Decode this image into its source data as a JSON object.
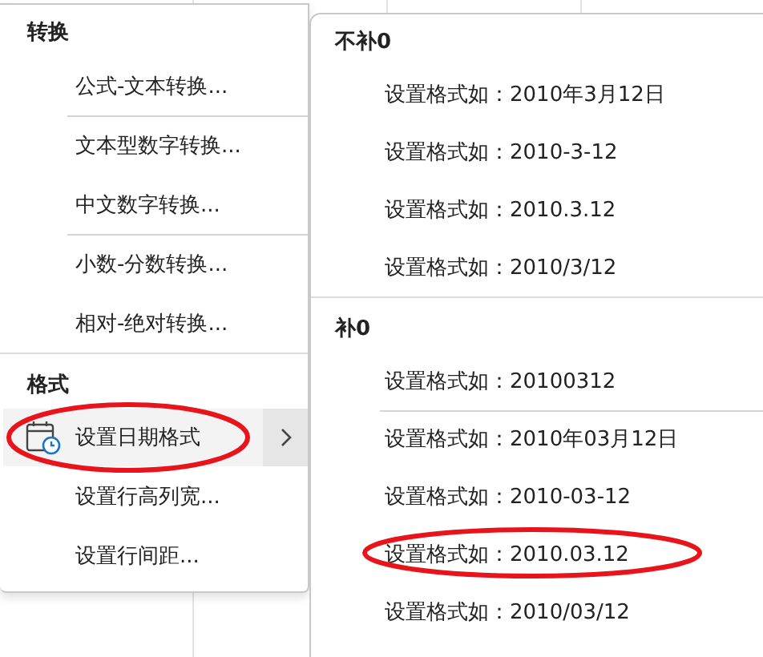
{
  "menu": {
    "sections": [
      {
        "heading": "转换",
        "items": [
          {
            "label": "公式-文本转换...",
            "divider_before": false,
            "selected": false,
            "has_icon": false,
            "has_submenu": false,
            "circled": false
          },
          {
            "label": "文本型数字转换...",
            "divider_before": true,
            "selected": false,
            "has_icon": false,
            "has_submenu": false,
            "circled": false
          },
          {
            "label": "中文数字转换...",
            "divider_before": false,
            "selected": false,
            "has_icon": false,
            "has_submenu": false,
            "circled": false
          },
          {
            "label": "小数-分数转换...",
            "divider_before": true,
            "selected": false,
            "has_icon": false,
            "has_submenu": false,
            "circled": false
          },
          {
            "label": "相对-绝对转换...",
            "divider_before": false,
            "selected": false,
            "has_icon": false,
            "has_submenu": false,
            "circled": false
          }
        ]
      },
      {
        "heading": "格式",
        "items": [
          {
            "label": "设置日期格式",
            "divider_before": false,
            "selected": true,
            "has_icon": true,
            "has_submenu": true,
            "circled": true
          },
          {
            "label": "设置行高列宽...",
            "divider_before": false,
            "selected": false,
            "has_icon": false,
            "has_submenu": false,
            "circled": false
          },
          {
            "label": "设置行间距...",
            "divider_before": false,
            "selected": false,
            "has_icon": false,
            "has_submenu": false,
            "circled": false
          }
        ]
      }
    ]
  },
  "submenu": {
    "sections": [
      {
        "heading": "不补0",
        "items": [
          {
            "label": "设置格式如：2010年3月12日",
            "divider_before": false,
            "circled": false
          },
          {
            "label": "设置格式如：2010-3-12",
            "divider_before": false,
            "circled": false
          },
          {
            "label": "设置格式如：2010.3.12",
            "divider_before": false,
            "circled": false
          },
          {
            "label": "设置格式如：2010/3/12",
            "divider_before": false,
            "circled": false
          }
        ]
      },
      {
        "heading": "补0",
        "items": [
          {
            "label": "设置格式如：20100312",
            "divider_before": false,
            "circled": false
          },
          {
            "label": "设置格式如：2010年03月12日",
            "divider_before": true,
            "circled": false
          },
          {
            "label": "设置格式如：2010-03-12",
            "divider_before": false,
            "circled": false
          },
          {
            "label": "设置格式如：2010.03.12",
            "divider_before": false,
            "circled": true
          },
          {
            "label": "设置格式如：2010/03/12",
            "divider_before": false,
            "circled": false
          }
        ]
      }
    ]
  }
}
